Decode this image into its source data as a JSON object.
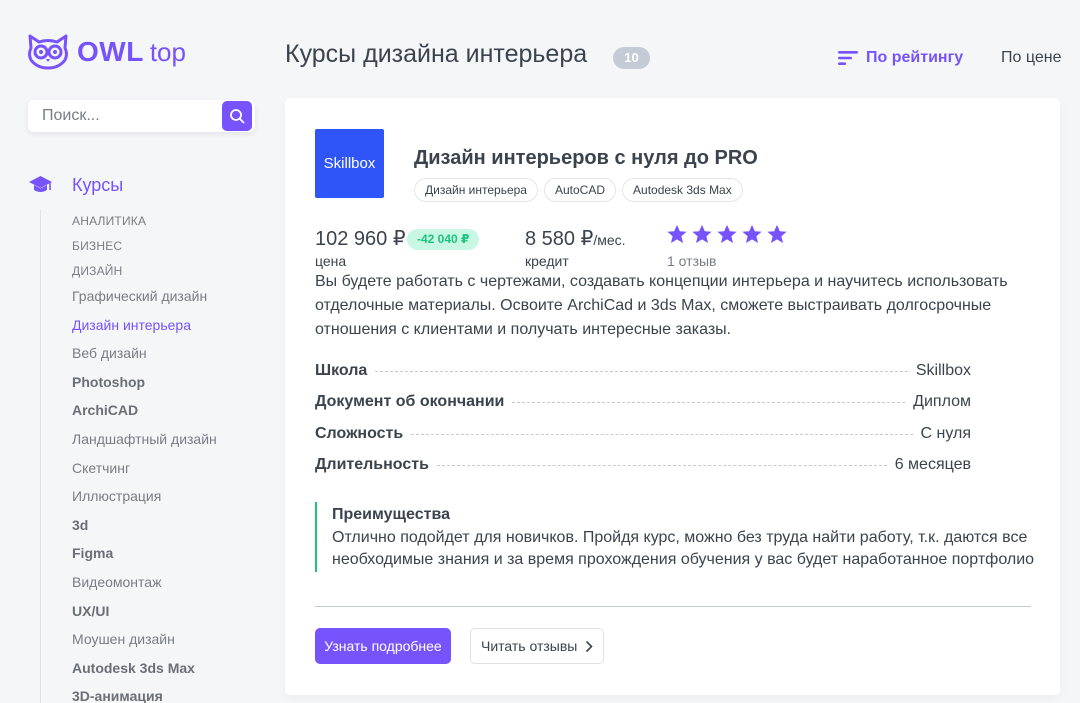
{
  "brand": {
    "name": "OWL",
    "suffix": "top"
  },
  "search": {
    "placeholder": "Поиск..."
  },
  "sidebar": {
    "category": "Курсы",
    "items": [
      {
        "label": "АНАЛИТИКА",
        "style": "caps"
      },
      {
        "label": "БИЗНЕС",
        "style": "caps"
      },
      {
        "label": "ДИЗАЙН",
        "style": "caps"
      },
      {
        "label": "Графический дизайн",
        "style": "normal"
      },
      {
        "label": "Дизайн интерьера",
        "style": "active"
      },
      {
        "label": "Веб дизайн",
        "style": "normal"
      },
      {
        "label": "Photoshop",
        "style": "bold"
      },
      {
        "label": "ArchiCAD",
        "style": "bold"
      },
      {
        "label": "Ландшафтный дизайн",
        "style": "normal"
      },
      {
        "label": "Скетчинг",
        "style": "normal"
      },
      {
        "label": "Иллюстрация",
        "style": "normal"
      },
      {
        "label": "3d",
        "style": "bold"
      },
      {
        "label": "Figma",
        "style": "bold"
      },
      {
        "label": "Видеомонтаж",
        "style": "normal"
      },
      {
        "label": "UX/UI",
        "style": "bold"
      },
      {
        "label": "Моушен дизайн",
        "style": "normal"
      },
      {
        "label": "Autodesk 3ds Max",
        "style": "bold"
      },
      {
        "label": "3D-анимация",
        "style": "bold"
      }
    ]
  },
  "header": {
    "title": "Курсы дизайна интерьера",
    "count": "10",
    "sort_rating": "По рейтингу",
    "sort_price": "По цене"
  },
  "course": {
    "school_logo_text": "Skillbox",
    "title": "Дизайн интерьеров с нуля до PRO",
    "tags": [
      "Дизайн интерьера",
      "AutoCAD",
      "Autodesk 3ds Max"
    ],
    "price": "102 960 ₽",
    "discount": "-42 040 ₽",
    "price_label": "цена",
    "credit": "8 580 ₽",
    "credit_unit": "/мес.",
    "credit_label": "кредит",
    "rating": 5,
    "reviews": "1 отзыв",
    "description": "Вы будете работать с чертежами, создавать концепции интерьера и научитесь использовать отделочные материалы. Освоите ArchiCad и 3ds Max, сможете выстраивать долгосрочные отношения с клиентами и получать интересные заказы.",
    "specs": [
      {
        "key": "Школа",
        "value": "Skillbox"
      },
      {
        "key": "Документ об окончании",
        "value": "Диплом"
      },
      {
        "key": "Сложность",
        "value": "С нуля"
      },
      {
        "key": "Длительность",
        "value": "6 месяцев"
      }
    ],
    "advantages_title": "Преимущества",
    "advantages_text": "Отлично подойдет для новичков. Пройдя курс, можно без труда найти работу, т.к. даются все необходимые знания и за время прохождения обучения у вас будет наработанное портфолио",
    "btn_more": "Узнать подробнее",
    "btn_reviews": "Читать отзывы"
  },
  "colors": {
    "accent": "#7653fc",
    "green": "#1dc37e",
    "school": "#2f54f7"
  }
}
